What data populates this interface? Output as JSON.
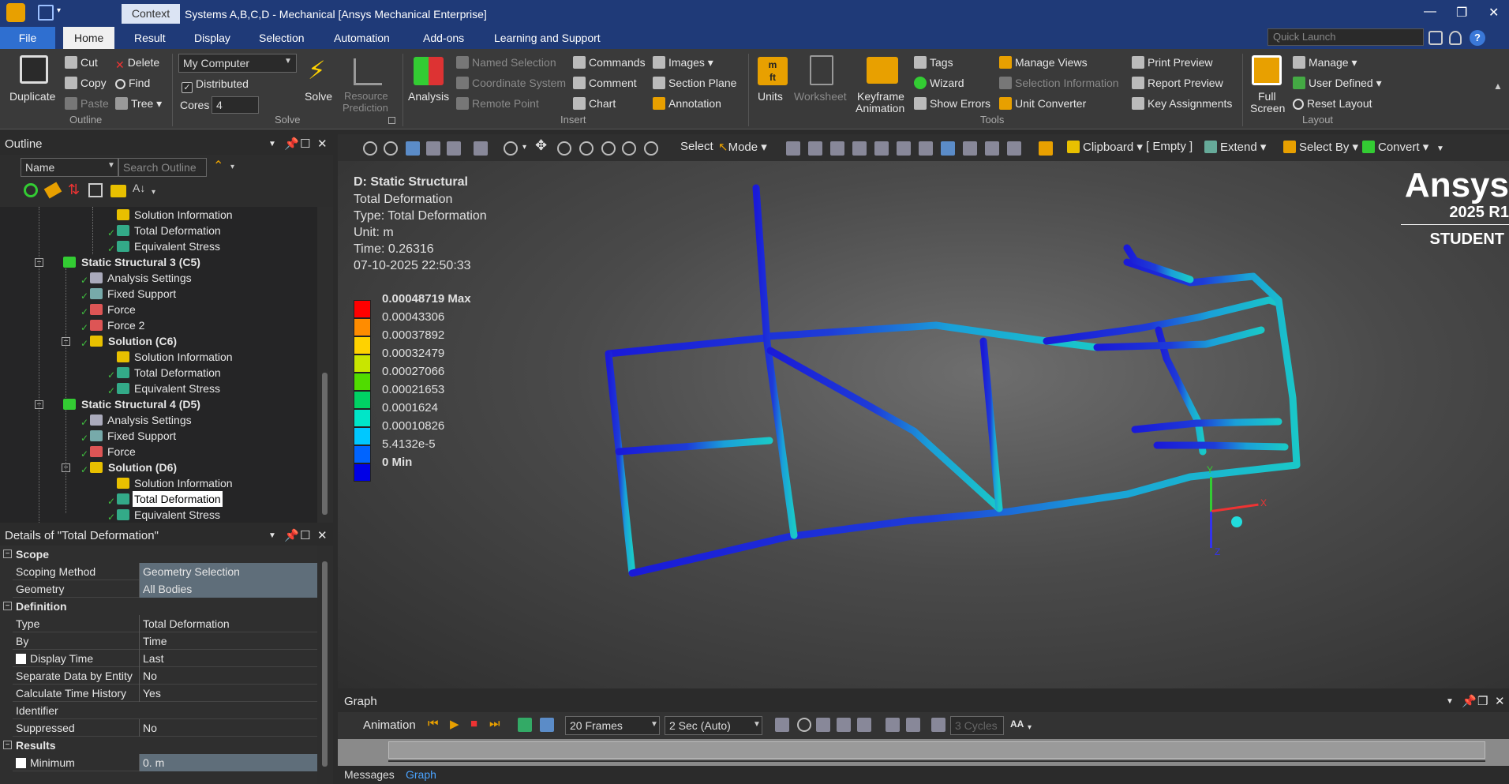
{
  "titlebar": {
    "context": "Context",
    "title": "Systems A,B,C,D - Mechanical [Ansys Mechanical Enterprise]"
  },
  "tabs": {
    "file": "File",
    "items": [
      "Home",
      "Result",
      "Display",
      "Selection",
      "Automation",
      "Add-ons",
      "Learning and Support"
    ],
    "active": "Home"
  },
  "quick_launch": {
    "placeholder": "Quick Launch"
  },
  "ribbon": {
    "outline": {
      "group": "Outline",
      "duplicate": "Duplicate",
      "cut": "Cut",
      "copy": "Copy",
      "paste": "Paste",
      "delete": "Delete",
      "find": "Find",
      "tree": "Tree"
    },
    "solve": {
      "group": "Solve",
      "location": "My Computer",
      "distributed": "Distributed",
      "cores_label": "Cores",
      "cores_value": "4",
      "solve": "Solve",
      "resource_prediction_1": "Resource",
      "resource_prediction_2": "Prediction"
    },
    "insert": {
      "group": "Insert",
      "analysis": "Analysis",
      "named_selection": "Named Selection",
      "coordinate_system": "Coordinate System",
      "remote_point": "Remote Point",
      "commands": "Commands",
      "comment": "Comment",
      "chart": "Chart",
      "images": "Images",
      "section_plane": "Section Plane",
      "annotation": "Annotation"
    },
    "tools": {
      "group": "Tools",
      "units": "Units",
      "worksheet": "Worksheet",
      "keyframe_1": "Keyframe",
      "keyframe_2": "Animation",
      "tags": "Tags",
      "wizard": "Wizard",
      "show_errors": "Show Errors",
      "manage_views": "Manage Views",
      "selection_information": "Selection Information",
      "unit_converter": "Unit Converter",
      "print_preview": "Print Preview",
      "report_preview": "Report Preview",
      "key_assignments": "Key Assignments"
    },
    "layout": {
      "group": "Layout",
      "full_screen_1": "Full",
      "full_screen_2": "Screen",
      "manage": "Manage",
      "user_defined": "User Defined",
      "reset_layout": "Reset Layout"
    }
  },
  "outline": {
    "title": "Outline",
    "name_filter": "Name",
    "search_placeholder": "Search Outline",
    "nodes": [
      {
        "label": "Solution Information",
        "bold": false
      },
      {
        "label": "Total Deformation",
        "bold": false
      },
      {
        "label": "Equivalent Stress",
        "bold": false
      },
      {
        "label": "Static Structural 3 (C5)",
        "bold": true
      },
      {
        "label": "Analysis Settings",
        "bold": false
      },
      {
        "label": "Fixed Support",
        "bold": false
      },
      {
        "label": "Force",
        "bold": false
      },
      {
        "label": "Force 2",
        "bold": false
      },
      {
        "label": "Solution (C6)",
        "bold": true
      },
      {
        "label": "Solution Information",
        "bold": false
      },
      {
        "label": "Total Deformation",
        "bold": false
      },
      {
        "label": "Equivalent Stress",
        "bold": false
      },
      {
        "label": "Static Structural 4 (D5)",
        "bold": true
      },
      {
        "label": "Analysis Settings",
        "bold": false
      },
      {
        "label": "Fixed Support",
        "bold": false
      },
      {
        "label": "Force",
        "bold": false
      },
      {
        "label": "Solution (D6)",
        "bold": true
      },
      {
        "label": "Solution Information",
        "bold": false
      },
      {
        "label": "Total Deformation",
        "bold": false,
        "selected": true
      },
      {
        "label": "Equivalent Stress",
        "bold": false
      }
    ]
  },
  "details": {
    "title": "Details of \"Total Deformation\"",
    "sections": {
      "scope": "Scope",
      "definition": "Definition",
      "results": "Results"
    },
    "rows": {
      "scoping_method": {
        "key": "Scoping Method",
        "value": "Geometry Selection"
      },
      "geometry": {
        "key": "Geometry",
        "value": "All Bodies"
      },
      "type": {
        "key": "Type",
        "value": "Total Deformation"
      },
      "by": {
        "key": "By",
        "value": "Time"
      },
      "display_time": {
        "key": "Display Time",
        "value": "Last"
      },
      "separate_data": {
        "key": "Separate Data by Entity",
        "value": "No"
      },
      "calc_time_history": {
        "key": "Calculate Time History",
        "value": "Yes"
      },
      "identifier": {
        "key": "Identifier",
        "value": ""
      },
      "suppressed": {
        "key": "Suppressed",
        "value": "No"
      },
      "minimum": {
        "key": "Minimum",
        "value": "0. m"
      }
    }
  },
  "graphics_toolbar": {
    "select": "Select",
    "mode": "Mode",
    "clipboard": "Clipboard",
    "empty": "[ Empty ]",
    "extend": "Extend",
    "select_by": "Select By",
    "convert": "Convert"
  },
  "viewport": {
    "info": [
      "D: Static Structural",
      "Total Deformation",
      "Type: Total Deformation",
      "Unit: m",
      "Time: 0.26316",
      "07-10-2025 22:50:33"
    ],
    "legend": {
      "max_label": "0.00048719 Max",
      "values": [
        "0.00043306",
        "0.00037892",
        "0.00032479",
        "0.00027066",
        "0.00021653",
        "0.0001624",
        "0.00010826",
        "5.4132e-5"
      ],
      "min_label": "0 Min",
      "colors": [
        "#ff0000",
        "#ff8c00",
        "#ffd200",
        "#c8e600",
        "#50dc00",
        "#00d264",
        "#00e6c8",
        "#00c8ff",
        "#0064ff",
        "#0000e6"
      ]
    },
    "triad": {
      "x": "X",
      "y": "Y",
      "z": "Z"
    }
  },
  "logo": {
    "brand": "Ansys",
    "version": "2025 R1",
    "edition": "STUDENT"
  },
  "graph": {
    "title": "Graph",
    "animation": "Animation",
    "frames": "20 Frames",
    "duration": "2 Sec (Auto)",
    "cycles_placeholder": "3 Cycles",
    "aa": "AA"
  },
  "bottom_tabs": {
    "messages": "Messages",
    "graph": "Graph"
  }
}
